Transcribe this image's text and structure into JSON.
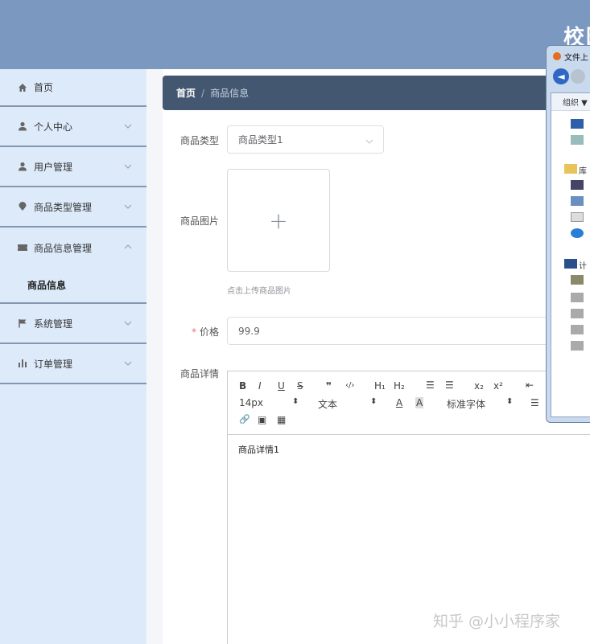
{
  "header": {
    "title": "校园"
  },
  "sidebar": {
    "items": [
      {
        "label": "首页",
        "icon": "home-icon"
      },
      {
        "label": "个人中心",
        "icon": "user-icon"
      },
      {
        "label": "用户管理",
        "icon": "user-icon"
      },
      {
        "label": "商品类型管理",
        "icon": "location-icon"
      },
      {
        "label": "商品信息管理",
        "icon": "ticket-icon"
      },
      {
        "label": "系统管理",
        "icon": "flag-icon"
      },
      {
        "label": "订单管理",
        "icon": "chart-icon"
      }
    ],
    "sub_item": "商品信息"
  },
  "breadcrumb": {
    "home": "首页",
    "sep": "/",
    "current": "商品信息"
  },
  "form": {
    "type_label": "商品类型",
    "type_value": "商品类型1",
    "image_label": "商品图片",
    "upload_plus": "+",
    "upload_tip": "点击上传商品图片",
    "price_required": "*",
    "price_label": "价格",
    "price_value": "99.9",
    "detail_label": "商品详情",
    "detail_content": "商品详情1"
  },
  "editor_toolbar": {
    "bold": "B",
    "italic": "I",
    "underline": "U",
    "strike": "S",
    "quote": "❞",
    "code": "‹/›",
    "h1": "H₁",
    "h2": "H₂",
    "ol": "☰",
    "ul": "☰",
    "sub": "x₂",
    "sup": "x²",
    "indent": "⇤",
    "size": "14px",
    "size_arrow": "⬍",
    "format": "文本",
    "format_arrow": "⬍",
    "color": "A",
    "bg": "A",
    "font": "标准字体",
    "font_arrow": "⬍",
    "align": "☰",
    "link": "🔗",
    "image": "▣",
    "video": "▦"
  },
  "dialog": {
    "title": "文件上",
    "org": "组织 ▼",
    "library": "库",
    "computer": "计"
  },
  "watermark": "知乎 @小小程序家",
  "colors": {
    "header_bg": "#7b98c0",
    "sidebar_bg": "#ddeafa",
    "breadcrumb_bg": "#435870",
    "required": "#f56c6c"
  }
}
